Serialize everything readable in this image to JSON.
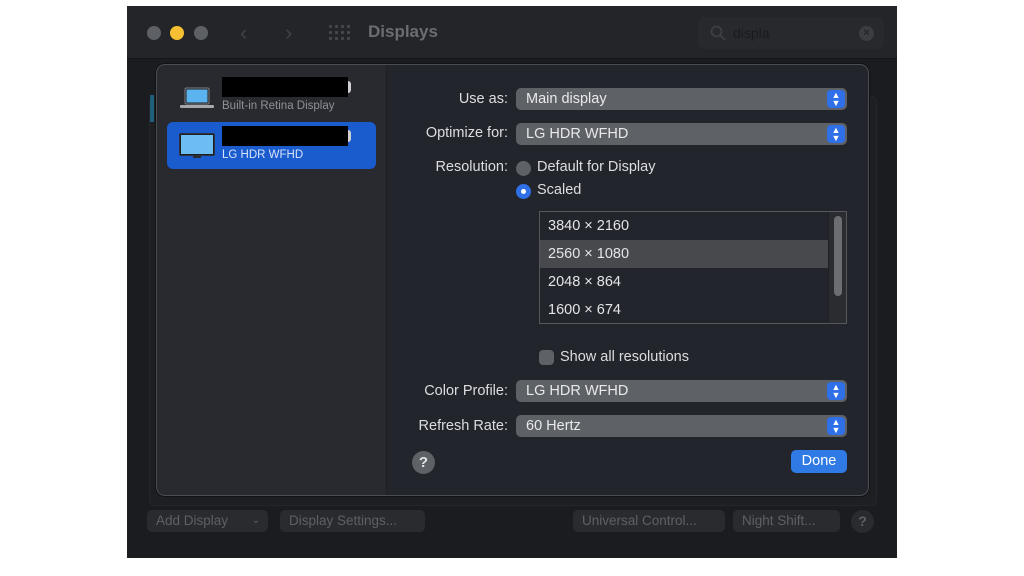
{
  "window": {
    "title": "Displays",
    "traffic_lights": {
      "close_color": "#5d6064",
      "minimize_color": "#f7c033",
      "maximize_color": "#5d6064"
    },
    "nav": {
      "back_icon": "chevron-left-icon",
      "forward_icon": "chevron-right-icon",
      "grid_icon": "show-all-grid-icon"
    },
    "search": {
      "value": "displa",
      "search_icon": "magnifier-icon",
      "clear_icon": "clear-x-icon",
      "clear_glyph": "×"
    }
  },
  "footer": {
    "add_display": "Add Display",
    "add_display_chevron": "⌄",
    "display_settings": "Display Settings...",
    "universal_control": "Universal Control...",
    "night_shift": "Night Shift...",
    "help": "?"
  },
  "sheet": {
    "sidebar": {
      "items": [
        {
          "name_redacted": true,
          "subtitle": "Built-in Retina Display",
          "icon": "laptop-icon",
          "selected": false
        },
        {
          "name_redacted": true,
          "subtitle": "LG HDR WFHD",
          "icon": "monitor-icon",
          "selected": true
        }
      ]
    },
    "use_as": {
      "label": "Use as:",
      "value": "Main display"
    },
    "optimize_for": {
      "label": "Optimize for:",
      "value": "LG HDR WFHD"
    },
    "resolution": {
      "label": "Resolution:",
      "options": [
        {
          "label": "Default for Display",
          "selected": false
        },
        {
          "label": "Scaled",
          "selected": true
        }
      ],
      "list": [
        "3840 × 2160",
        "2560 × 1080",
        "2048 × 864",
        "1600 × 674"
      ],
      "selected_index": 1
    },
    "show_all_resolutions": {
      "label": "Show all resolutions",
      "checked": false
    },
    "color_profile": {
      "label": "Color Profile:",
      "value": "LG HDR WFHD"
    },
    "refresh_rate": {
      "label": "Refresh Rate:",
      "value": "60 Hertz"
    },
    "help": "?",
    "done": "Done",
    "popup_arrow_glyph": "⌃⌄"
  },
  "colors": {
    "accent": "#2f7ae5",
    "selection": "#1a5bce",
    "sheet_bg": "#22252b"
  }
}
